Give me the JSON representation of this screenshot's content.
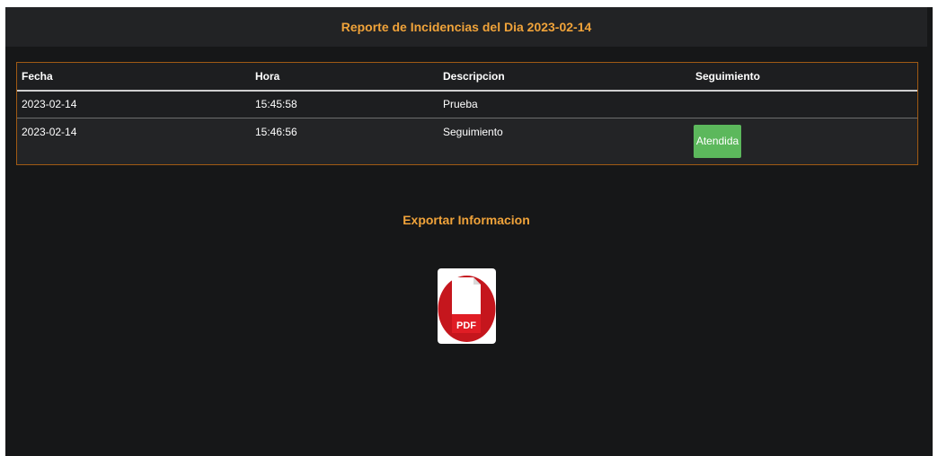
{
  "header": {
    "title": "Reporte de Incidencias del Dia 2023-02-14"
  },
  "table": {
    "columns": [
      "Fecha",
      "Hora",
      "Descripcion",
      "Seguimiento"
    ],
    "rows": [
      {
        "fecha": "2023-02-14",
        "hora": "15:45:58",
        "descripcion": "Prueba",
        "seguimiento": ""
      },
      {
        "fecha": "2023-02-14",
        "hora": "15:46:56",
        "descripcion": "Seguimiento",
        "seguimiento": "Atendida"
      }
    ]
  },
  "export": {
    "title": "Exportar Informacion",
    "pdf_label": "PDF",
    "pdf_icon": "pdf-file-icon"
  },
  "colors": {
    "background": "#161718",
    "accent": "#f0a33a",
    "success": "#5cb85c",
    "pdf_red": "#c5161d"
  }
}
